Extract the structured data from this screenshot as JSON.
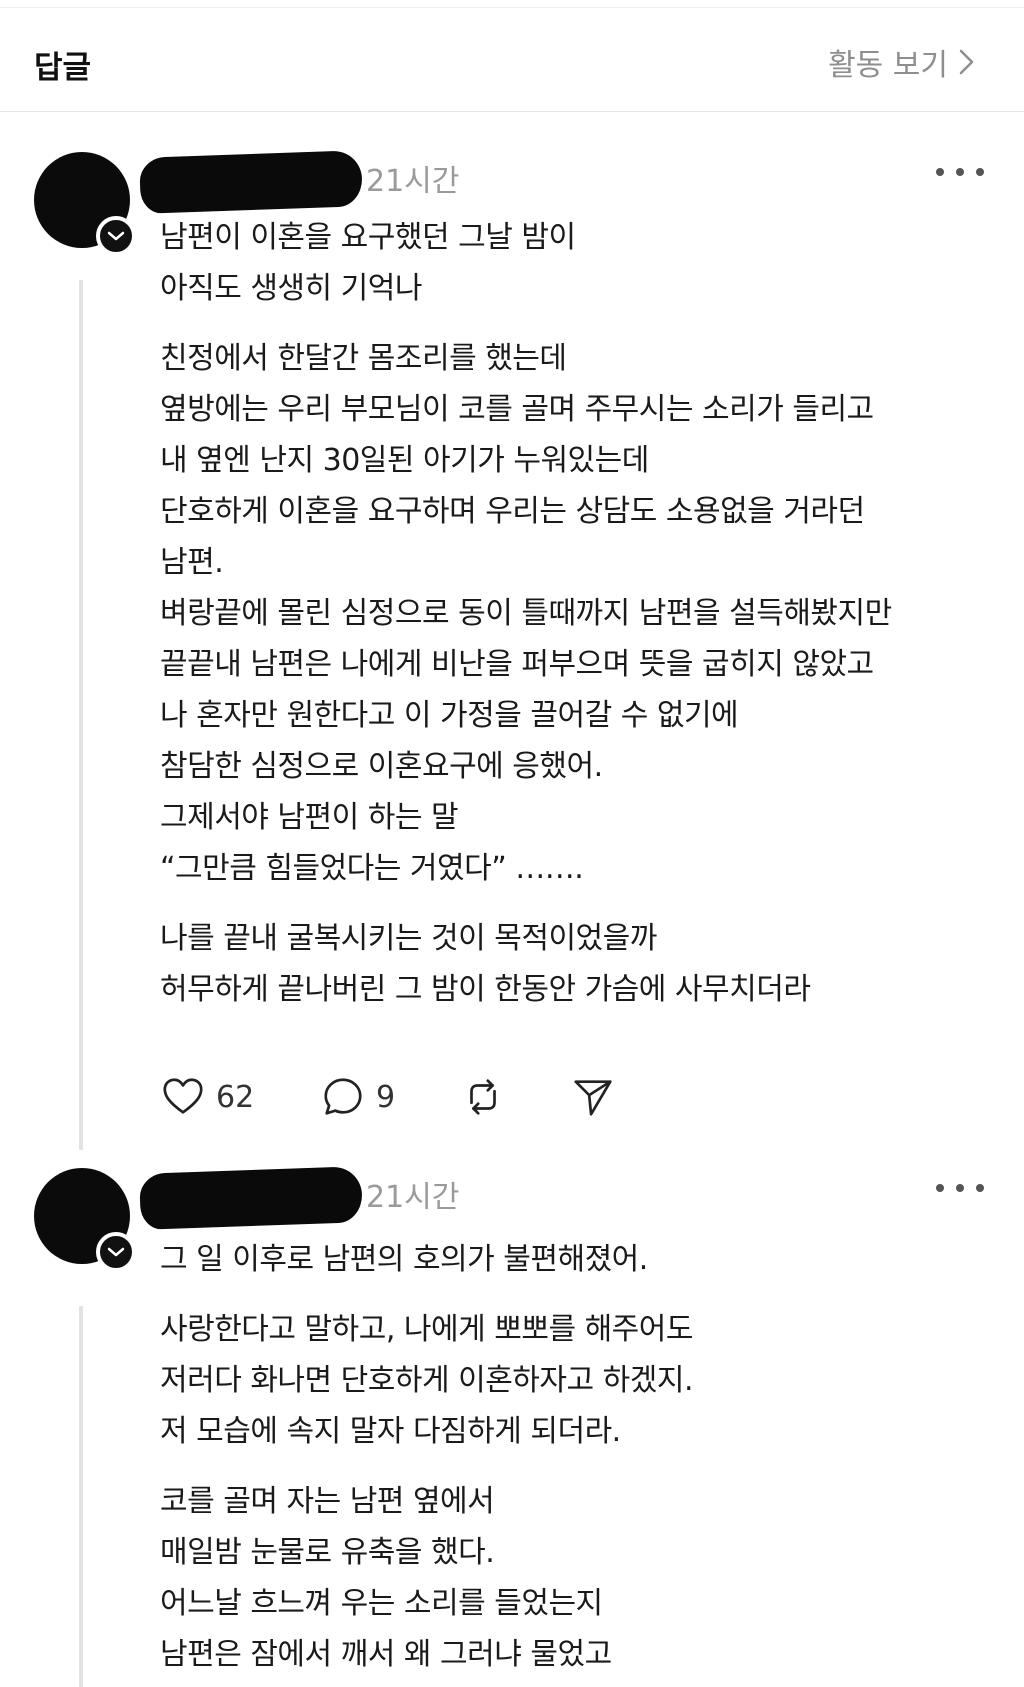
{
  "header": {
    "title": "답글",
    "activity_link": "활동 보기"
  },
  "posts": [
    {
      "timestamp": "21시간",
      "paragraphs": [
        [
          "남편이 이혼을 요구했던 그날 밤이",
          "아직도 생생히 기억나"
        ],
        [
          "친정에서 한달간 몸조리를 했는데",
          "옆방에는 우리 부모님이 코를 골며 주무시는 소리가 들리고",
          "내 옆엔 난지 30일된 아기가 누워있는데",
          "단호하게 이혼을 요구하며 우리는 상담도 소용없을 거라던",
          "남편.",
          "벼랑끝에 몰린 심정으로 동이 틀때까지 남편을 설득해봤지만",
          "끝끝내 남편은 나에게 비난을 퍼부으며 뜻을 굽히지 않았고",
          "나 혼자만 원한다고 이 가정을 끌어갈 수 없기에",
          "참담한 심정으로 이혼요구에 응했어.",
          "그제서야 남편이 하는 말",
          "“그만큼 힘들었다는 거였다” ……."
        ],
        [
          "나를 끝내 굴복시키는 것이 목적이었을까",
          "허무하게 끝나버린 그 밤이 한동안 가슴에 사무치더라"
        ]
      ],
      "likes": "62",
      "replies": "9"
    },
    {
      "timestamp": "21시간",
      "paragraphs": [
        [
          "그 일 이후로 남편의 호의가 불편해졌어."
        ],
        [
          "사랑한다고 말하고, 나에게 뽀뽀를 해주어도",
          "저러다 화나면 단호하게 이혼하자고 하겠지.",
          "저 모습에 속지 말자 다짐하게 되더라."
        ],
        [
          "코를 골며 자는 남편 옆에서",
          "매일밤 눈물로 유축을 했다.",
          "어느날 흐느껴 우는 소리를 들었는지",
          "남편은 잠에서 깨서 왜 그러냐 물었고"
        ]
      ]
    }
  ],
  "icons": {
    "like": "heart-icon",
    "reply": "comment-bubble-icon",
    "repost": "repost-icon",
    "share": "send-icon",
    "more": "more-dots-icon",
    "follow": "chevron-down-icon",
    "activity_chevron": "chevron-right-icon"
  },
  "colors": {
    "text": "#1a1a1a",
    "muted": "#9a9a9a",
    "divider": "#e6e6e6",
    "thread_line": "#e3e3e3"
  }
}
